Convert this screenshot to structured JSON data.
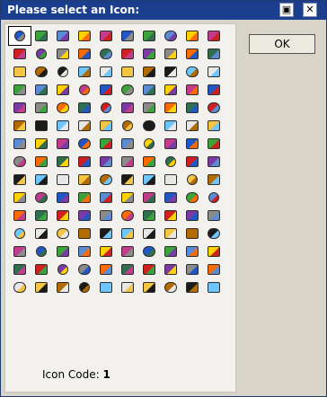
{
  "dialog": {
    "title": "Please select an Icon:",
    "ok_label": "OK",
    "icon_code_label": "Icon Code:",
    "icon_code_value": "1",
    "selected_icon_index": 0
  },
  "icons": {
    "count": 150,
    "columns": 10,
    "palette": [
      "#1f57c8",
      "#d21f1f",
      "#f4c542",
      "#3aa33a",
      "#7b3aa6",
      "#b36b00",
      "#5a8bd6",
      "#8b8b8b",
      "#1b1b1b",
      "#ffd200",
      "#ff6a00",
      "#6ec6ff",
      "#c23b8c",
      "#2f6f4f",
      "#e7e7e7"
    ]
  }
}
